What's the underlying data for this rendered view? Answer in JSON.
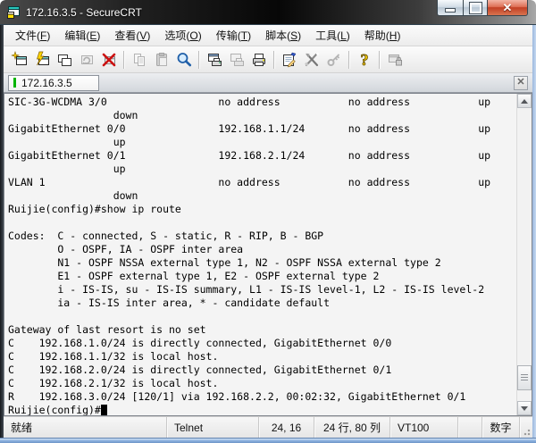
{
  "window": {
    "title": "172.16.3.5 - SecureCRT"
  },
  "menu_bar": {
    "items": [
      {
        "id": "file",
        "pre": "文件",
        "key": "F"
      },
      {
        "id": "edit",
        "pre": "编辑",
        "key": "E"
      },
      {
        "id": "view",
        "pre": "查看",
        "key": "V"
      },
      {
        "id": "options",
        "pre": "选项",
        "key": "O"
      },
      {
        "id": "transfer",
        "pre": "传输",
        "key": "T"
      },
      {
        "id": "script",
        "pre": "脚本",
        "key": "S"
      },
      {
        "id": "tools",
        "pre": "工具",
        "key": "L"
      },
      {
        "id": "help",
        "pre": "帮助",
        "key": "H"
      }
    ]
  },
  "toolbar": {
    "icons": [
      "connect",
      "quick-connect",
      "connect-in-tab",
      "reconnect",
      "disconnect",
      "copy",
      "paste",
      "find",
      "print-window",
      "print-preview",
      "print",
      "session-options",
      "global-options",
      "key",
      "help",
      "locked-window"
    ]
  },
  "tab_bar": {
    "tabs": [
      {
        "label": "172.16.3.5",
        "active": true
      }
    ]
  },
  "terminal": {
    "lines": [
      "SIC-3G-WCDMA 3/0                  no address           no address           up",
      "                 down",
      "GigabitEthernet 0/0               192.168.1.1/24       no address           up",
      "                 up",
      "GigabitEthernet 0/1               192.168.2.1/24       no address           up",
      "                 up",
      "VLAN 1                            no address           no address           up",
      "                 down",
      "Ruijie(config)#show ip route",
      "",
      "Codes:  C - connected, S - static, R - RIP, B - BGP",
      "        O - OSPF, IA - OSPF inter area",
      "        N1 - OSPF NSSA external type 1, N2 - OSPF NSSA external type 2",
      "        E1 - OSPF external type 1, E2 - OSPF external type 2",
      "        i - IS-IS, su - IS-IS summary, L1 - IS-IS level-1, L2 - IS-IS level-2",
      "        ia - IS-IS inter area, * - candidate default",
      "",
      "Gateway of last resort is no set",
      "C    192.168.1.0/24 is directly connected, GigabitEthernet 0/0",
      "C    192.168.1.1/32 is local host.",
      "C    192.168.2.0/24 is directly connected, GigabitEthernet 0/1",
      "C    192.168.2.1/32 is local host.",
      "R    192.168.3.0/24 [120/1] via 192.168.2.2, 00:02:32, GigabitEthernet 0/1"
    ],
    "prompt": "Ruijie(config)#"
  },
  "status_bar": {
    "ready": "就绪",
    "protocol": "Telnet",
    "cursor_position": "24, 16",
    "terminal_size": "24 行, 80 列",
    "emulation": "VT100",
    "num_lock": "数字"
  },
  "colors": {
    "tab_indicator_green": "#00b400",
    "close_button_red": "#c23f24",
    "terminal_background": "#f4f4f4",
    "terminal_text": "#000000"
  }
}
